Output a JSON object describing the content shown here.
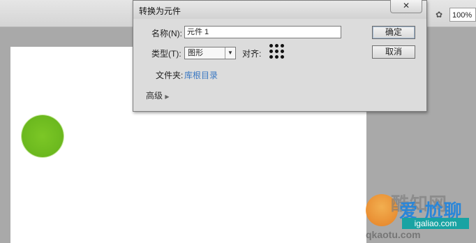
{
  "toolbar": {
    "zoom_value": "100%",
    "icons": [
      "scene-icon",
      "symbol-edit-icon"
    ]
  },
  "dialog": {
    "title": "转换为元件",
    "close_label": "✕",
    "name_label": "名称(N):",
    "name_value": "元件 1",
    "type_label": "类型(T):",
    "type_value": "图形",
    "align_label": "对齐:",
    "folder_label": "文件夹:",
    "folder_value": "库根目录",
    "advanced_label": "高级",
    "ok_label": "确定",
    "cancel_label": "取消"
  },
  "stage": {
    "circle_color": "#6bb81e"
  },
  "watermark": {
    "text_back": "酷知网",
    "text_front": "爱·尬聊",
    "url": "igaliao.com",
    "bottom": "qkaotu.com"
  }
}
